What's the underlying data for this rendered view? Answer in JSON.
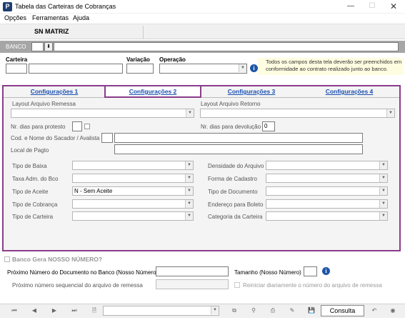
{
  "window": {
    "title": "Tabela das Carteiras de Cobranças",
    "app_icon_letter": "P"
  },
  "menu": [
    "Opções",
    "Ferramentas",
    "Ajuda"
  ],
  "header": {
    "company": "SN MATRIZ"
  },
  "banco": {
    "label": "BANCO"
  },
  "top_fields": {
    "carteira_label": "Carteira",
    "variacao_label": "Variação",
    "operacao_label": "Operação",
    "note": "Todos os campos desta tela deverão ser preenchidos em conformidade ao contrato realizado junto ao banco."
  },
  "tabs": [
    {
      "label": "Configurações 1"
    },
    {
      "label": "Configurações 2"
    },
    {
      "label": "Configurações 3"
    },
    {
      "label": "Configurações 4"
    }
  ],
  "config": {
    "layout_remessa": "Layout Arquivo Remessa",
    "layout_retorno": "Layout Arquivo Retorno",
    "dias_protesto": "Nr. dias para protesto",
    "dias_devolucao": "Nr. dias para devolução",
    "dias_devolucao_value": "0",
    "sacador": "Cod. e Nome do Sacador / Avalista",
    "local_pagto": "Local de Pagto",
    "left": [
      {
        "label": "Tipo de Baixa",
        "value": ""
      },
      {
        "label": "Taxa Adm. do Bco",
        "value": ""
      },
      {
        "label": "Tipo de Aceite",
        "value": "N - Sem Aceite"
      },
      {
        "label": "Tipo de Cobrança",
        "value": ""
      },
      {
        "label": "Tipo de Carteira",
        "value": ""
      }
    ],
    "right": [
      {
        "label": "Densidade do Arquivo",
        "value": ""
      },
      {
        "label": "Forma de Cadastro",
        "value": ""
      },
      {
        "label": "Tipo de Documento",
        "value": ""
      },
      {
        "label": "Endereço para Boleto",
        "value": ""
      },
      {
        "label": "Categoria da Carteira",
        "value": ""
      }
    ]
  },
  "bottom": {
    "banco_gera": "Banco Gera NOSSO NÚMERO?",
    "proximo_numero": "Próximo Número do Documento no Banco (Nosso Número)",
    "tamanho": "Tamanho (Nosso Número)",
    "proximo_seq": "Próximo número sequencial do arquivo de remessa",
    "reiniciar": "Reiniciar diariamente o número do arquivo de remessa"
  },
  "statusbar": {
    "consulta": "Consulta"
  }
}
